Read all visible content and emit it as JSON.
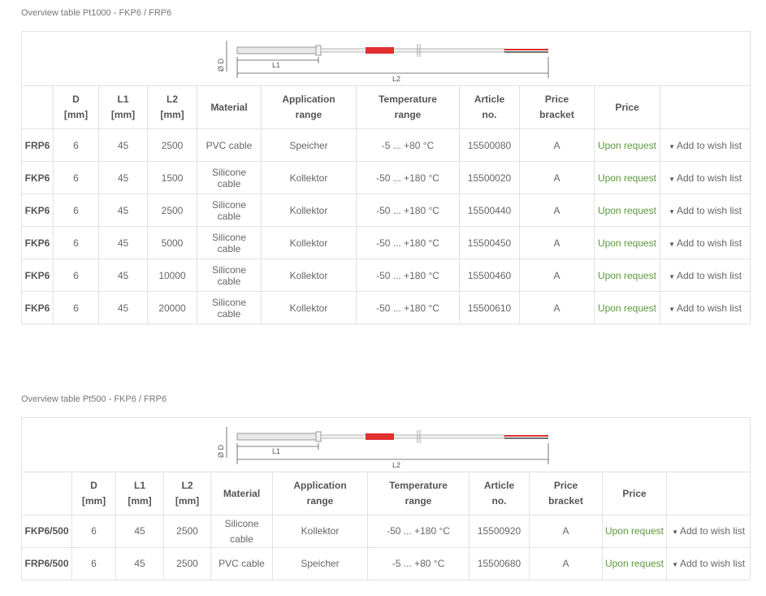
{
  "tables": [
    {
      "caption": "Overview table Pt1000 - FKP6 / FRP6",
      "diagram": {
        "d_label": "Ø D",
        "l1_label": "L1",
        "l2_label": "L2"
      },
      "headers": [
        "",
        "D\n[mm]",
        "L1\n[mm]",
        "L2\n[mm]",
        "Material",
        "Application\nrange",
        "Temperature\nrange",
        "Article\nno.",
        "Price\nbracket",
        "Price",
        ""
      ],
      "rows": [
        {
          "name": "FRP6",
          "d": "6",
          "l1": "45",
          "l2": "2500",
          "material": "PVC cable",
          "application": "Speicher",
          "temperature": "-5 ... +80 °C",
          "article": "15500080",
          "bracket": "A",
          "price": "Upon request",
          "wish": "Add to wish list"
        },
        {
          "name": "FKP6",
          "d": "6",
          "l1": "45",
          "l2": "1500",
          "material": "Silicone cable",
          "application": "Kollektor",
          "temperature": "-50 ... +180 °C",
          "article": "15500020",
          "bracket": "A",
          "price": "Upon request",
          "wish": "Add to wish list"
        },
        {
          "name": "FKP6",
          "d": "6",
          "l1": "45",
          "l2": "2500",
          "material": "Silicone cable",
          "application": "Kollektor",
          "temperature": "-50 ... +180 °C",
          "article": "15500440",
          "bracket": "A",
          "price": "Upon request",
          "wish": "Add to wish list"
        },
        {
          "name": "FKP6",
          "d": "6",
          "l1": "45",
          "l2": "5000",
          "material": "Silicone cable",
          "application": "Kollektor",
          "temperature": "-50 ... +180 °C",
          "article": "15500450",
          "bracket": "A",
          "price": "Upon request",
          "wish": "Add to wish list"
        },
        {
          "name": "FKP6",
          "d": "6",
          "l1": "45",
          "l2": "10000",
          "material": "Silicone cable",
          "application": "Kollektor",
          "temperature": "-50 ... +180 °C",
          "article": "15500460",
          "bracket": "A",
          "price": "Upon request",
          "wish": "Add to wish list"
        },
        {
          "name": "FKP6",
          "d": "6",
          "l1": "45",
          "l2": "20000",
          "material": "Silicone cable",
          "application": "Kollektor",
          "temperature": "-50 ... +180 °C",
          "article": "15500610",
          "bracket": "A",
          "price": "Upon request",
          "wish": "Add to wish list"
        }
      ]
    },
    {
      "caption": "Overview table Pt500 - FKP6 / FRP6",
      "diagram": {
        "d_label": "Ø D",
        "l1_label": "L1",
        "l2_label": "L2"
      },
      "headers": [
        "",
        "D\n[mm]",
        "L1\n[mm]",
        "L2\n[mm]",
        "Material",
        "Application\nrange",
        "Temperature\nrange",
        "Article\nno.",
        "Price\nbracket",
        "Price",
        ""
      ],
      "rows": [
        {
          "name": "FKP6/500",
          "d": "6",
          "l1": "45",
          "l2": "2500",
          "material": "Silicone cable",
          "application": "Kollektor",
          "temperature": "-50 ... +180 °C",
          "article": "15500920",
          "bracket": "A",
          "price": "Upon request",
          "wish": "Add to wish list"
        },
        {
          "name": "FRP6/500",
          "d": "6",
          "l1": "45",
          "l2": "2500",
          "material": "PVC cable",
          "application": "Speicher",
          "temperature": "-5 ... +80 °C",
          "article": "15500680",
          "bracket": "A",
          "price": "Upon request",
          "wish": "Add to wish list"
        }
      ]
    }
  ],
  "colors": {
    "price_link": "#5a9a3c",
    "sensor_red": "#e03030",
    "border": "#e2e2e2"
  },
  "icons": {
    "wish": "pin-icon"
  }
}
